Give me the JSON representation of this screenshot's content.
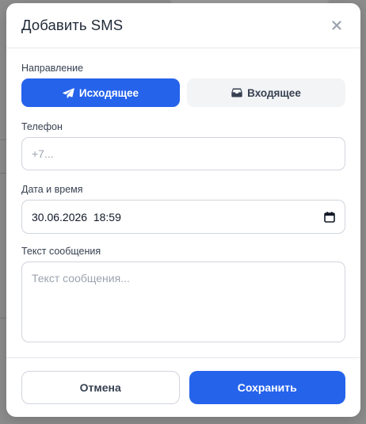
{
  "modal": {
    "title": "Добавить SMS"
  },
  "direction": {
    "label": "Направление",
    "outgoing_label": "Исходящее",
    "incoming_label": "Входящее",
    "selected": "outgoing"
  },
  "phone": {
    "label": "Телефон",
    "placeholder": "+7...",
    "value": ""
  },
  "datetime": {
    "label": "Дата и время",
    "value": "30.06.2026  18:59"
  },
  "message": {
    "label": "Текст сообщения",
    "placeholder": "Текст сообщения...",
    "value": ""
  },
  "footer": {
    "cancel_label": "Отмена",
    "save_label": "Сохранить"
  },
  "colors": {
    "accent": "#2563eb",
    "overlay": "#8d8d8d",
    "inactive_bg": "#f3f4f6",
    "border": "#d1d5db"
  },
  "icons": {
    "close": "close-icon",
    "outgoing": "paper-plane-icon",
    "incoming": "inbox-icon",
    "calendar": "calendar-icon"
  }
}
